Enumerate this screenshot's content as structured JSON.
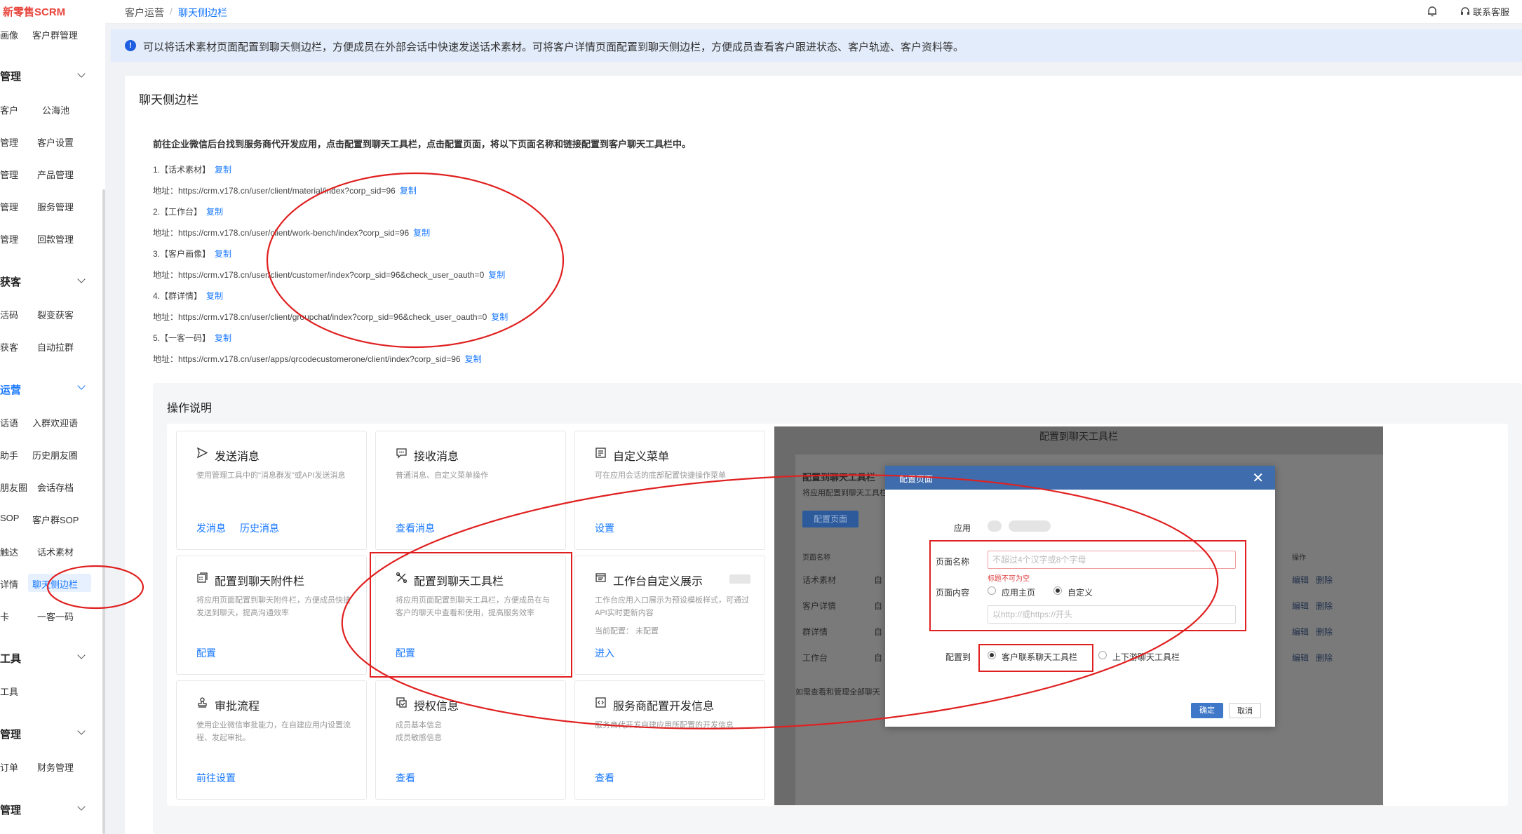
{
  "app": {
    "logo": "新零售SCRM"
  },
  "sidebar": {
    "truncated_labels": [
      {
        "left": "画像",
        "right": "客户群管理"
      },
      {
        "left": "客户",
        "right": "公海池"
      },
      {
        "left": "管理",
        "right": "客户设置"
      },
      {
        "left": "管理",
        "right": "产品管理"
      },
      {
        "left": "管理",
        "right": "服务管理"
      },
      {
        "left": "管理",
        "right": "回款管理"
      },
      {
        "left": "活码",
        "right": "裂变获客"
      },
      {
        "left": "获客",
        "right": "自动拉群"
      },
      {
        "left": "话语",
        "right": "入群欢迎语"
      },
      {
        "left": "助手",
        "right": "历史朋友圈"
      },
      {
        "left": "朋友圈",
        "right": "会话存档"
      },
      {
        "left": "SOP",
        "right": "客户群SOP"
      },
      {
        "left": "触达",
        "right": "话术素材"
      },
      {
        "left": "详情",
        "right": "聊天侧边栏"
      },
      {
        "left": "卡",
        "right": "一客一码"
      },
      {
        "left": "工具",
        "right": ""
      },
      {
        "left": "订单",
        "right": "财务管理"
      }
    ],
    "sections": [
      "管理",
      "获客",
      "运营",
      "工具",
      "管理",
      "管理"
    ]
  },
  "topbar": {
    "breadcrumb": [
      "客户运营",
      "/",
      "聊天侧边栏"
    ],
    "service": "联系客服"
  },
  "notice": {
    "text": "可以将话术素材页面配置到聊天侧边栏，方便成员在外部会话中快速发送话术素材。可将客户详情页面配置到聊天侧边栏，方便成员查看客户跟进状态、客户轨迹、客户资料等。"
  },
  "main": {
    "title": "聊天侧边栏",
    "guide": "前往企业微信后台找到服务商代开发应用，点击配置到聊天工具栏，点击配置页面，将以下页面名称和链接配置到客户聊天工具栏中。",
    "copy_label": "复制",
    "items": [
      {
        "name": "1.【话术素材】",
        "url": "地址：https://crm.v178.cn/user/client/material/index?corp_sid=96"
      },
      {
        "name": "2.【工作台】",
        "url": "地址：https://crm.v178.cn/user/client/work-bench/index?corp_sid=96"
      },
      {
        "name": "3.【客户画像】",
        "url": "地址：https://crm.v178.cn/user/client/customer/index?corp_sid=96&check_user_oauth=0"
      },
      {
        "name": "4.【群详情】",
        "url": "地址：https://crm.v178.cn/user/client/groupchat/index?corp_sid=96&check_user_oauth=0"
      },
      {
        "name": "5.【一客一码】",
        "url": "地址：https://crm.v178.cn/user/apps/qrcodecustomerone/client/index?corp_sid=96"
      }
    ]
  },
  "ops": {
    "title": "操作说明",
    "cards": [
      {
        "title": "发送消息",
        "desc": "使用管理工具中的\"消息群发\"或API发送消息",
        "links": [
          "发消息",
          "历史消息"
        ]
      },
      {
        "title": "接收消息",
        "desc": "普通消息、自定义菜单操作",
        "links": [
          "查看消息"
        ]
      },
      {
        "title": "自定义菜单",
        "desc": "可在应用会话的底部配置快捷操作菜单",
        "links": [
          "设置"
        ]
      },
      {
        "title": "配置到聊天附件栏",
        "desc": "将应用页面配置到聊天附件栏，方便成员快捷发送到聊天，提高沟通效率",
        "links": [
          "配置"
        ]
      },
      {
        "title": "配置到聊天工具栏",
        "desc": "将应用页面配置到聊天工具栏，方便成员在与客户的聊天中查看和使用，提高服务效率",
        "links": [
          "配置"
        ]
      },
      {
        "title": "工作台自定义展示",
        "desc": "工作台应用入口展示为预设模板样式，可通过API实时更新内容",
        "current": "当前配置：  未配置",
        "links": [
          "进入"
        ]
      },
      {
        "title": "审批流程",
        "desc": "使用企业微信审批能力，在自建应用内设置流程、发起审批。",
        "links": [
          "前往设置"
        ]
      },
      {
        "title": "授权信息",
        "desc": "成员基本信息\n成员敏感信息",
        "links": [
          "查看"
        ]
      },
      {
        "title": "服务商配置开发信息",
        "desc": "服务商代开发自建应用所配置的开发信息",
        "links": [
          "查看"
        ]
      }
    ]
  },
  "overlay": {
    "title": "配置到聊天工具栏",
    "section_title": "配置到聊天工具栏",
    "section_desc": "将应用配置到聊天工具栏",
    "config_button": "配置页面",
    "col_name": "页面名称",
    "col_op": "操作",
    "rows": [
      "话术素材",
      "客户详情",
      "群详情",
      "工作台"
    ],
    "row_marker": "自",
    "edit": "编辑",
    "delete": "删除",
    "footer": "如需查看和管理全部聊天"
  },
  "dialog": {
    "title": "配置页面",
    "close": "✕",
    "app_label": "应用",
    "page_name_label": "页面名称",
    "page_name_placeholder": "不超过4个汉字或8个字母",
    "page_name_error": "标题不可为空",
    "page_content_label": "页面内容",
    "content_options": [
      "应用主页",
      "自定义"
    ],
    "content_selected": "自定义",
    "url_placeholder": "以http://或https://开头",
    "config_to_label": "配置到",
    "config_options": [
      "客户联系聊天工具栏",
      "上下游聊天工具栏"
    ],
    "config_selected": "客户联系聊天工具栏",
    "ok": "确定",
    "cancel": "取消"
  },
  "colors": {
    "accent": "#1677ff",
    "annotation": "#e02020",
    "dialog_header": "#3f6cad"
  }
}
